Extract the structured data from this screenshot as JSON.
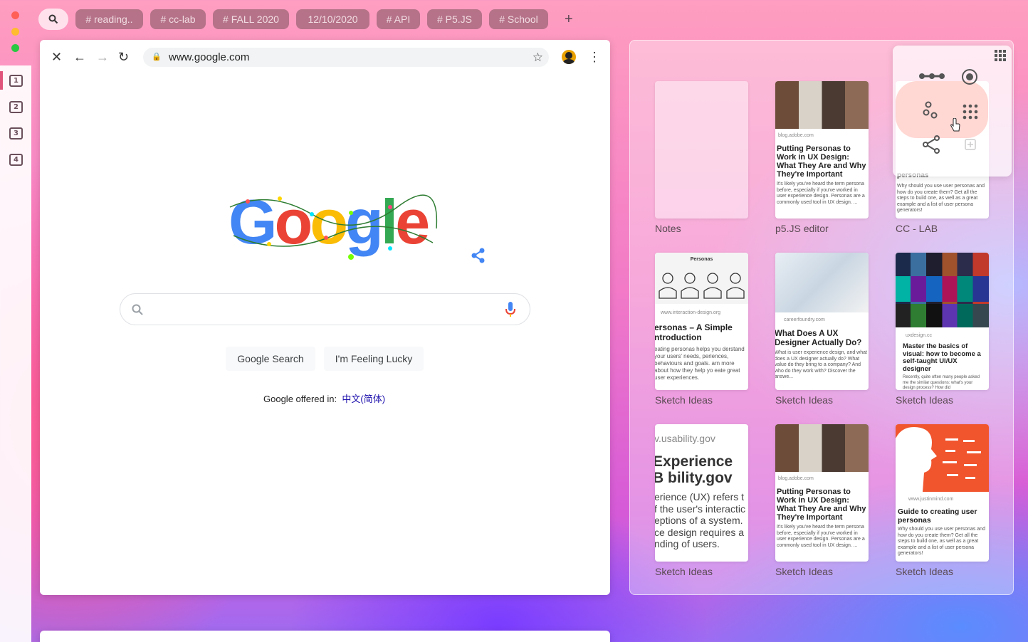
{
  "tabs_bar": {
    "search_icon": "search-icon",
    "tags": [
      "# reading..",
      "# cc-lab",
      "# FALL 2020",
      "12/10/2020",
      "# API",
      "# P5.JS",
      "# School"
    ],
    "add_label": "+"
  },
  "left_rail": {
    "items": [
      "1",
      "2",
      "3",
      "4"
    ]
  },
  "browser": {
    "url": "www.google.com",
    "logo_letters": [
      "G",
      "o",
      "o",
      "g",
      "l",
      "e"
    ],
    "search_button": "Google Search",
    "lucky_button": "I'm Feeling Lucky",
    "offered_in": "Google offered in:",
    "offered_lang": "中文(简体)"
  },
  "panel": {
    "cards": [
      {
        "caption": "Notes"
      },
      {
        "caption": "p5.JS editor",
        "source": "blog.adobe.com",
        "title": "Putting Personas to Work in UX Design: What They Are and Why They're Important",
        "desc": "It's likely you've heard the term persona before, especially if you've worked in user experience design. Personas are a commonly used tool in UX design. ..."
      },
      {
        "caption": "CC - LAB",
        "title": "personas",
        "desc": "Why should you use user personas and how do you create them? Get all the steps to build one, as well as a great example and a list of user persona generators!"
      },
      {
        "caption": "Sketch Ideas",
        "header": "Personas",
        "source": "www.interaction-design.org",
        "title": "ersonas – A Simple ntroduction",
        "desc": "eating personas helps you derstand your users' needs, periences, behaviours and goals. arn more about how they help yo eate great user experiences."
      },
      {
        "caption": "Sketch Ideas",
        "source": "careerfoundry.com",
        "title": "What Does A UX Designer Actually Do?",
        "desc": "What is user experience design, and what does a UX designer actually do? What value do they bring to a company? And who do they work with? Discover the answe..."
      },
      {
        "caption": "Sketch Ideas",
        "source": "uxdesign.cc",
        "title": "Master the basics of visual: how to become a self-taught UI/UX designer",
        "desc": "Recently, quite often many people asked me the similar questions: what's your design process? How did"
      },
      {
        "caption": "Sketch Ideas",
        "source": "v.usability.gov",
        "title": "Experience B bility.gov",
        "desc": "erience (UX) refers t f the user's interactic eptions of a system. ce design requires a nding of users."
      },
      {
        "caption": "Sketch Ideas",
        "source": "blog.adobe.com",
        "title": "Putting Personas to Work in UX Design: What They Are and Why They're Important",
        "desc": "It's likely you've heard the term persona before, especially if you've worked in user experience design. Personas are a commonly used tool in UX design. ..."
      },
      {
        "caption": "Sketch Ideas",
        "source": "www.justinmind.com",
        "title": "Guide to creating user personas",
        "desc": "Why should you use user personas and how do you create them? Get all the steps to build one, as well as a great example and a list of user persona generators!"
      }
    ]
  },
  "colors": {
    "google_blue": "#4285f4",
    "google_red": "#ea4335",
    "google_yellow": "#fbbc05",
    "google_green": "#34a853",
    "accent_pink": "#e0557c"
  }
}
